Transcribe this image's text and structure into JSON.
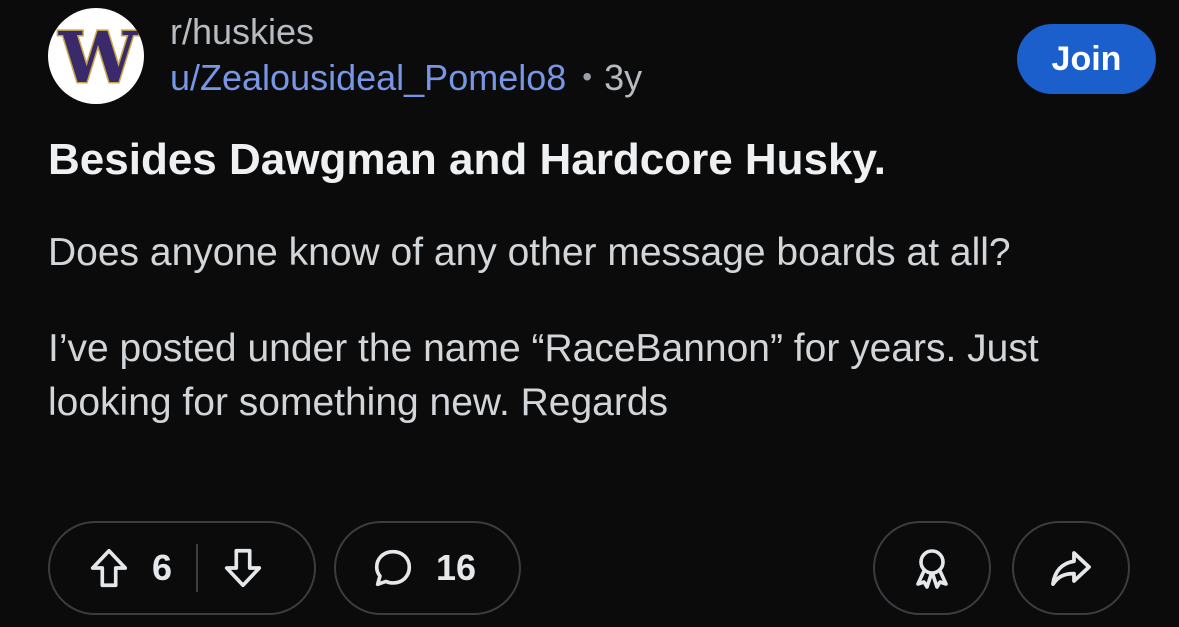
{
  "header": {
    "subreddit": "r/huskies",
    "username": "u/Zealousideal_Pomelo8",
    "separator": "•",
    "age": "3y",
    "join_label": "Join",
    "avatar_letter": "W"
  },
  "post": {
    "title": "Besides Dawgman and Hardcore Husky.",
    "paragraphs": [
      "Does anyone know of any other message boards at all?",
      "I’ve posted under the name “RaceBannon” for years. Just looking for something new.   Regards"
    ]
  },
  "actions": {
    "upvote_icon": "arrow-up-icon",
    "vote_count": "6",
    "downvote_icon": "arrow-down-icon",
    "comment_icon": "speech-bubble-icon",
    "comment_count": "16",
    "award_icon": "award-ribbon-icon",
    "share_icon": "share-arrow-icon"
  },
  "colors": {
    "background": "#0b0b0c",
    "username": "#7896e6",
    "join_button": "#1a5fcc",
    "pill_border": "#3a3d41"
  }
}
